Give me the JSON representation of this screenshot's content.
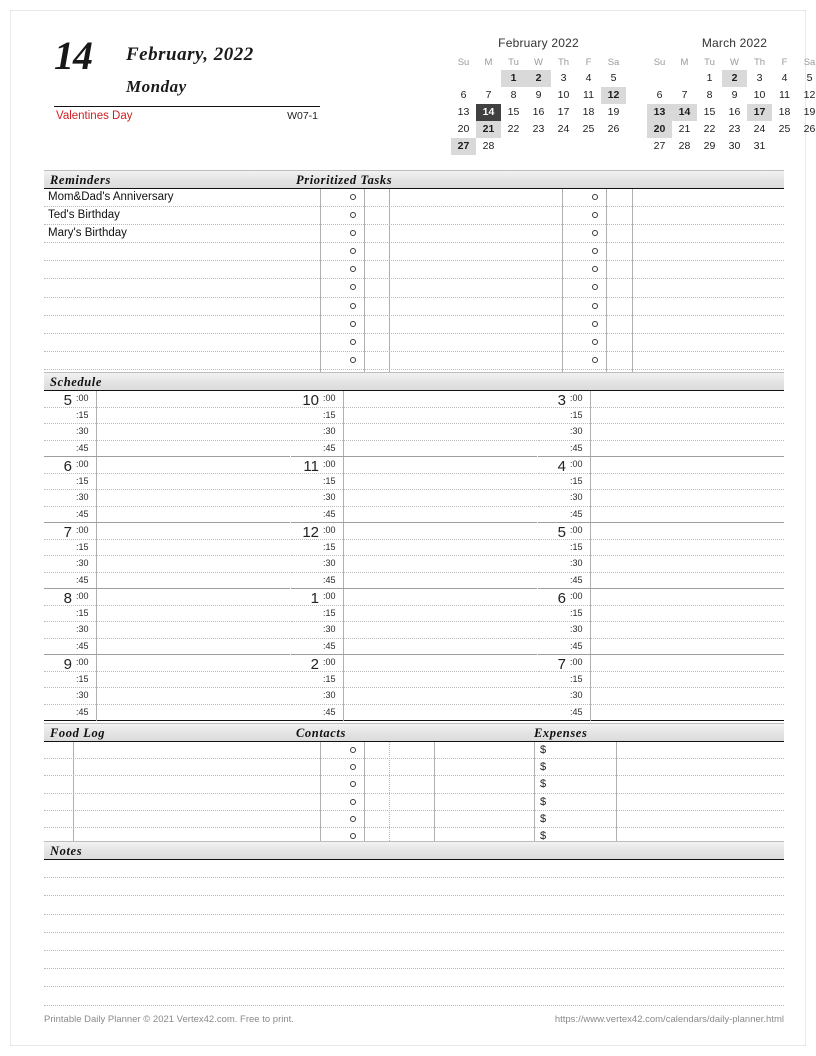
{
  "header": {
    "day_number": "14",
    "month_year": "February, 2022",
    "weekday": "Monday",
    "holiday": "Valentines Day",
    "week_code": "W07-1"
  },
  "calendars": [
    {
      "id": "february",
      "title": "February 2022",
      "dow": [
        "Su",
        "M",
        "Tu",
        "W",
        "Th",
        "F",
        "Sa"
      ],
      "lead_blanks": 2,
      "days": 28,
      "highlighted": [
        1,
        2,
        12,
        21,
        27
      ],
      "today": 14
    },
    {
      "id": "march",
      "title": "March 2022",
      "dow": [
        "Su",
        "M",
        "Tu",
        "W",
        "Th",
        "F",
        "Sa"
      ],
      "lead_blanks": 2,
      "days": 31,
      "highlighted": [
        2,
        13,
        14,
        17,
        20
      ],
      "today": null
    }
  ],
  "sections": {
    "reminders": {
      "title": "Reminders",
      "rows": 11,
      "entries": [
        "Mom&Dad's Anniversary",
        "Ted's Birthday",
        "Mary's Birthday"
      ]
    },
    "prioritized_tasks": {
      "title": "Prioritized Tasks",
      "rows": 11,
      "columns": 2,
      "entries_left": [],
      "entries_right": []
    },
    "schedule": {
      "title": "Schedule",
      "minute_labels": [
        ":00",
        ":15",
        ":30",
        ":45"
      ],
      "columns": [
        {
          "hours": [
            "5",
            "6",
            "7",
            "8",
            "9"
          ]
        },
        {
          "hours": [
            "10",
            "11",
            "12",
            "1",
            "2"
          ]
        },
        {
          "hours": [
            "3",
            "4",
            "5",
            "6",
            "7"
          ]
        }
      ]
    },
    "food_log": {
      "title": "Food Log",
      "rows": 6
    },
    "contacts": {
      "title": "Contacts",
      "rows": 6
    },
    "expenses": {
      "title": "Expenses",
      "rows": 6,
      "currency_symbol": "$"
    },
    "notes": {
      "title": "Notes",
      "rows": 8
    }
  },
  "footer": {
    "left": "Printable Daily Planner © 2021 Vertex42.com. Free to print.",
    "right": "https://www.vertex42.com/calendars/daily-planner.html"
  },
  "colors": {
    "holiday_red": "#d22020",
    "today_bg": "#404040",
    "highlight_bg": "#d9d9d9",
    "rule_black": "#111111",
    "dotted_gray": "#b9b9b9"
  }
}
